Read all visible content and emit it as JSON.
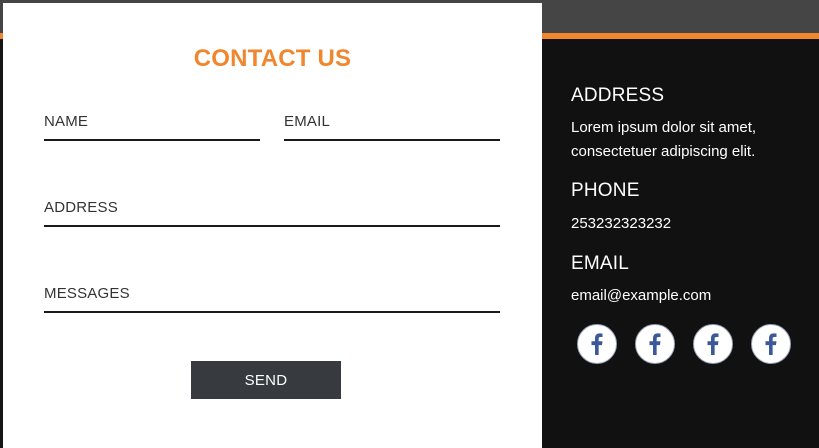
{
  "form": {
    "title": "CONTACT US",
    "fields": {
      "name": {
        "label": "NAME",
        "value": ""
      },
      "email": {
        "label": "EMAIL",
        "value": ""
      },
      "address": {
        "label": "ADDRESS",
        "value": ""
      },
      "messages": {
        "label": "MESSAGES",
        "value": ""
      }
    },
    "send_label": "SEND"
  },
  "info": {
    "address_heading": "ADDRESS",
    "address_text": "Lorem ipsum dolor sit amet, consectetuer adipiscing elit.",
    "phone_heading": "PHONE",
    "phone_text": "253232323232",
    "email_heading": "EMAIL",
    "email_text": "email@example.com"
  },
  "social": [
    {
      "icon": "facebook-icon"
    },
    {
      "icon": "facebook-icon"
    },
    {
      "icon": "facebook-icon"
    },
    {
      "icon": "facebook-icon"
    }
  ],
  "colors": {
    "accent": "#f0862d",
    "topbar": "#454545",
    "panel": "#111111",
    "button": "#373b40",
    "facebook": "#3b5998"
  }
}
